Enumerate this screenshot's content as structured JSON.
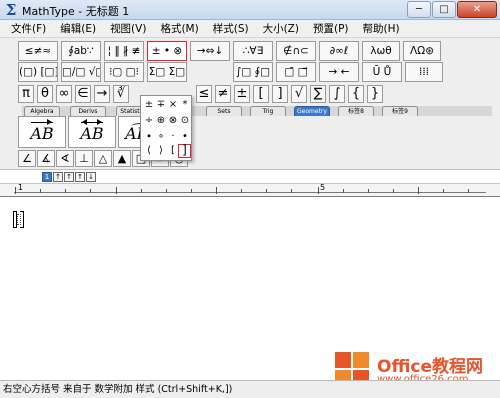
{
  "window": {
    "title": "MathType - 无标题 1",
    "buttons": {
      "minimize": "─",
      "maximize": "□",
      "close": "✕"
    }
  },
  "menu": [
    "文件(F)",
    "编辑(E)",
    "视图(V)",
    "格式(M)",
    "样式(S)",
    "大小(Z)",
    "预置(P)",
    "帮助(H)"
  ],
  "toolbar": {
    "row1": [
      "≤≠≈",
      "∮ab∵",
      "¦ ‖ ∦ ≢",
      "± • ⊗",
      "→⇔↓",
      "∴∀∃",
      "∉∩⊂",
      "∂∞ℓ",
      "λωθ",
      "ΛΩ⊛"
    ],
    "row2": [
      "(□) [□]",
      "□/□ √□",
      "⁝▢ □⁝",
      "Σ□ Σ□",
      "∫□ ∮□",
      "□̄ □⃗",
      "→ ←",
      "Ū Ů",
      "⁞⁞⁞"
    ],
    "row3": [
      "π",
      "θ",
      "∞",
      "∈",
      "→",
      "∛",
      "≤",
      "≠",
      "±",
      "[",
      "]",
      "√",
      "∑",
      "∫",
      "{",
      "}"
    ],
    "tabs": [
      "Algebra",
      "Derivs",
      "Statistics",
      "Sets",
      "Trig",
      "Geometry",
      "标签8",
      "标签9"
    ],
    "selected_tab": "Geometry",
    "templates": [
      "AB",
      "AB",
      "ABC"
    ],
    "geometry": [
      "∠",
      "∡",
      "∢",
      "⊥",
      "△",
      "▲",
      "□",
      "▱",
      "○"
    ]
  },
  "dropdown": {
    "cells": [
      "±",
      "∓",
      "×",
      "*",
      "÷",
      "⊕",
      "⊗",
      "⊙",
      "⟨",
      "⟩",
      "[",
      "]",
      "•",
      "·",
      "∘",
      "∙"
    ],
    "selected": "]"
  },
  "small_tools": [
    "1",
    "↑",
    "↑",
    "↑",
    "↓"
  ],
  "ruler": {
    "labels": [
      "1",
      "5"
    ]
  },
  "status": {
    "text": "右空心方括号 来自于 数学附加 样式 (Ctrl+Shift+K,])"
  },
  "watermark": {
    "brand": "Office教程网",
    "url": "www.office26.com"
  },
  "colors": {
    "accent_red": "#e0262d",
    "tab_blue": "#3c78c8",
    "watermark_orange": "#e8542a"
  }
}
